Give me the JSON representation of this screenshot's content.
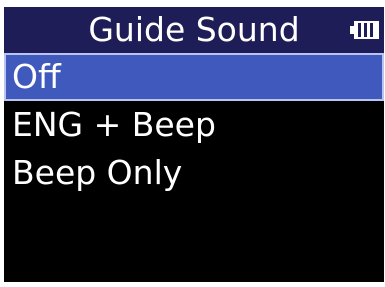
{
  "screen": {
    "title": "Guide Sound",
    "battery_icon": "battery-icon",
    "colors": {
      "title_bar": "#1f1d57",
      "selection": "#3f59bd",
      "background": "#000000",
      "text": "#ffffff"
    }
  },
  "menu": {
    "items": [
      {
        "label": "Off",
        "selected": true
      },
      {
        "label": "ENG + Beep",
        "selected": false
      },
      {
        "label": "Beep Only",
        "selected": false
      }
    ]
  }
}
